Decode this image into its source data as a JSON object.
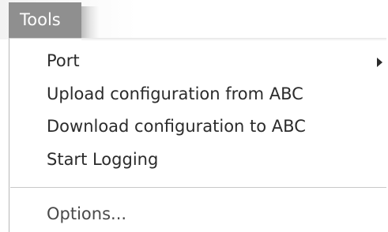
{
  "menu": {
    "header_label": "Tools",
    "items": [
      {
        "label": "Port",
        "has_submenu": true
      },
      {
        "label": "Upload configuration from ABC"
      },
      {
        "label": "Download configuration to ABC"
      },
      {
        "label": "Start Logging"
      },
      {
        "label": "Options..."
      }
    ]
  },
  "colors": {
    "header_background": "#8f8f8f",
    "header_text": "#ffffff",
    "item_text": "#2b2b2b",
    "separator": "#c8c8c8"
  }
}
